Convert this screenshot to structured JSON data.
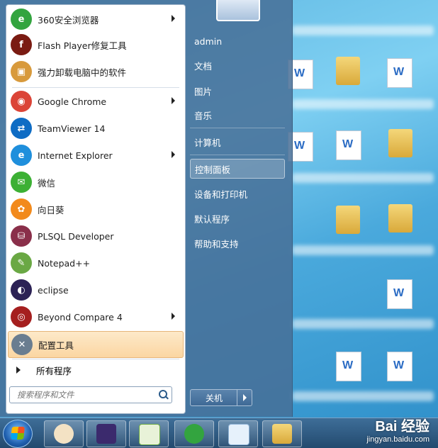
{
  "start_menu": {
    "programs": [
      {
        "label": "360安全浏览器",
        "icon": "360-browser-icon",
        "color": "#33a43f",
        "glyph": "e",
        "has_arrow": true
      },
      {
        "label": "Flash Player修复工具",
        "icon": "flash-player-icon",
        "color": "#7a1b12",
        "glyph": "f",
        "has_arrow": false
      },
      {
        "label": "强力卸载电脑中的软件",
        "icon": "uninstall-box-icon",
        "color": "#d89a3c",
        "glyph": "▣",
        "has_arrow": false
      },
      {
        "label": "Google Chrome",
        "icon": "chrome-icon",
        "color": "#db4437",
        "glyph": "◉",
        "has_arrow": true
      },
      {
        "label": "TeamViewer 14",
        "icon": "teamviewer-icon",
        "color": "#0e6cc4",
        "glyph": "⇄",
        "has_arrow": false
      },
      {
        "label": "Internet Explorer",
        "icon": "internet-explorer-icon",
        "color": "#1f8fdc",
        "glyph": "e",
        "has_arrow": true
      },
      {
        "label": "微信",
        "icon": "wechat-icon",
        "color": "#3cb034",
        "glyph": "✉",
        "has_arrow": false
      },
      {
        "label": "向日葵",
        "icon": "sunflower-icon",
        "color": "#f28a1c",
        "glyph": "✿",
        "has_arrow": false
      },
      {
        "label": "PLSQL Developer",
        "icon": "plsql-developer-icon",
        "color": "#8a2f4a",
        "glyph": "⛁",
        "has_arrow": false
      },
      {
        "label": "Notepad++",
        "icon": "notepad-plus-plus-icon",
        "color": "#6aa844",
        "glyph": "✎",
        "has_arrow": false
      },
      {
        "label": "eclipse",
        "icon": "eclipse-icon",
        "color": "#2c2255",
        "glyph": "◐",
        "has_arrow": false
      },
      {
        "label": "Beyond Compare 4",
        "icon": "beyond-compare-icon",
        "color": "#a51f1f",
        "glyph": "◎",
        "has_arrow": true
      },
      {
        "label": "配置工具",
        "icon": "config-tool-icon",
        "color": "#6a7d90",
        "glyph": "✕",
        "has_arrow": false
      }
    ],
    "all_programs": "所有程序",
    "search_placeholder": "搜索程序和文件",
    "right_items": [
      "admin",
      "文档",
      "图片",
      "音乐",
      "计算机",
      "控制面板",
      "设备和打印机",
      "默认程序",
      "帮助和支持"
    ],
    "shutdown": "关机"
  },
  "watermark": {
    "brand": "Bai 经验",
    "url": "jingyan.baidu.com"
  }
}
